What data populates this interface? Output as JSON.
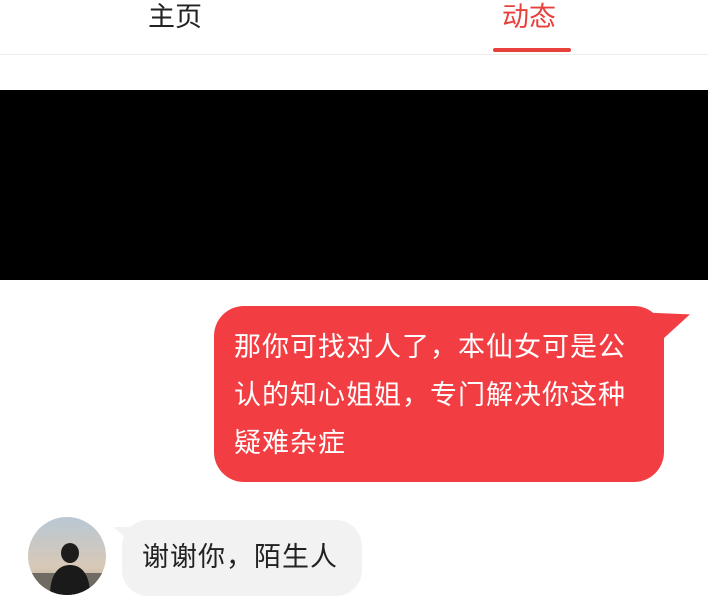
{
  "tabs": {
    "home_label": "主页",
    "feed_label": "动态",
    "active": "feed"
  },
  "colors": {
    "accent": "#e8403b",
    "outgoing_bubble": "#f23e42",
    "incoming_bubble": "#f2f2f2",
    "redaction": "#000000"
  },
  "messages": [
    {
      "direction": "outgoing",
      "text": "那你可找对人了，本仙女可是公认的知心姐姐，专门解决你这种疑难杂症"
    },
    {
      "direction": "incoming",
      "text": "谢谢你，陌生人",
      "avatar_icon": "user-avatar-photo"
    }
  ]
}
